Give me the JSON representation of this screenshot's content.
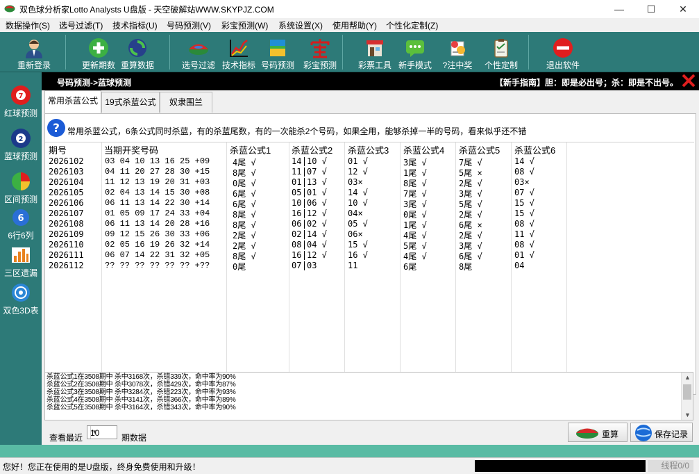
{
  "window": {
    "title": "双色球分析家Lotto Analysts U盘版 - 天空破解站WWW.SKYPJZ.COM",
    "minimize": "—",
    "maximize": "☐",
    "close": "✕"
  },
  "menu": [
    "数据操作(S)",
    "选号过滤(T)",
    "技术指标(U)",
    "号码预测(V)",
    "彩宝预测(W)",
    "系统设置(X)",
    "使用帮助(Y)",
    "个性化定制(Z)"
  ],
  "toolbar": [
    "重新登录",
    "更新期数",
    "重算数据",
    "选号过滤",
    "技术指标",
    "号码预测",
    "彩宝预测",
    "彩票工具",
    "新手模式",
    "?注中奖",
    "个性定制",
    "退出软件"
  ],
  "sidebar": [
    "红球预测",
    "蓝球预测",
    "区间预测",
    "6行6列",
    "三区遗漏",
    "双色3D表"
  ],
  "sidebar_icon_text": {
    "ball": "7",
    "two": "2",
    "six": "6"
  },
  "breadcrumb": "号码预测->蓝球预测",
  "guide": "【新手指南】胆：即是必出号；杀：即是不出号。",
  "tabs": [
    "常用杀蓝公式",
    "19式杀蓝公式",
    "奴隶围兰"
  ],
  "description": "常用杀蓝公式，6条公式同时杀蓝，有的杀蓝尾数，有的一次能杀2个号码，如果全用，能够杀掉一半的号码，看来似乎还不错",
  "headers": [
    "期号",
    "当期开奖号码",
    "杀蓝公式1",
    "杀蓝公式2",
    "杀蓝公式3",
    "杀蓝公式4",
    "杀蓝公式5",
    "杀蓝公式6"
  ],
  "rows": [
    {
      "period": "2026102",
      "numbers": "03 04 10 13 16 25 +09",
      "f1": "4尾 √",
      "f2a": "14",
      "f2b": "10 √",
      "f3": "01 √",
      "f4": "3尾 √",
      "f5": "7尾 √",
      "f6": "14 √"
    },
    {
      "period": "2026103",
      "numbers": "04 11 20 27 28 30 +15",
      "f1": "8尾 √",
      "f2a": "11",
      "f2b": "07 √",
      "f3": "12 √",
      "f4": "1尾 √",
      "f5": "5尾 ×",
      "f6": "08 √"
    },
    {
      "period": "2026104",
      "numbers": "11 12 13 19 20 31 +03",
      "f1": "0尾 √",
      "f2a": "01",
      "f2b": "13 √",
      "f3": "03×",
      "f4": "8尾 √",
      "f5": "2尾 √",
      "f6": "03×"
    },
    {
      "period": "2026105",
      "numbers": "02 04 13 14 15 30 +08",
      "f1": "6尾 √",
      "f2a": "05",
      "f2b": "01 √",
      "f3": "14 √",
      "f4": "7尾 √",
      "f5": "3尾 √",
      "f6": "07 √"
    },
    {
      "period": "2026106",
      "numbers": "06 11 13 14 22 30 +14",
      "f1": "6尾 √",
      "f2a": "10",
      "f2b": "06 √",
      "f3": "10 √",
      "f4": "3尾 √",
      "f5": "5尾 √",
      "f6": "15 √"
    },
    {
      "period": "2026107",
      "numbers": "01 05 09 17 24 33 +04",
      "f1": "8尾 √",
      "f2a": "16",
      "f2b": "12 √",
      "f3": "04×",
      "f4": "0尾 √",
      "f5": "2尾 √",
      "f6": "15 √"
    },
    {
      "period": "2026108",
      "numbers": "06 11 13 14 20 28 +16",
      "f1": "8尾 √",
      "f2a": "06",
      "f2b": "02 √",
      "f3": "05 √",
      "f4": "1尾 √",
      "f5": "6尾 ×",
      "f6": "08 √"
    },
    {
      "period": "2026109",
      "numbers": "09 12 15 26 30 33 +06",
      "f1": "2尾 √",
      "f2a": "02",
      "f2b": "14 √",
      "f3": "06×",
      "f4": "4尾 √",
      "f5": "2尾 √",
      "f6": "11 √"
    },
    {
      "period": "2026110",
      "numbers": "02 05 16 19 26 32 +14",
      "f1": "2尾 √",
      "f2a": "08",
      "f2b": "04 √",
      "f3": "15 √",
      "f4": "5尾 √",
      "f5": "3尾 √",
      "f6": "08 √"
    },
    {
      "period": "2026111",
      "numbers": "06 07 14 22 31 32 +05",
      "f1": "8尾 √",
      "f2a": "16",
      "f2b": "12 √",
      "f3": "16 √",
      "f4": "4尾 √",
      "f5": "6尾 √",
      "f6": "01 √"
    },
    {
      "period": "2026112",
      "numbers": "?? ?? ?? ?? ?? ?? +??",
      "f1": "0尾",
      "f2a": "07",
      "f2b": "03",
      "f3": "11",
      "f4": "6尾",
      "f5": "8尾",
      "f6": "04"
    }
  ],
  "stats": [
    "杀蓝公式1在3508期中 杀中3168次，杀错339次，命中率为90%",
    "杀蓝公式2在3508期中 杀中3078次，杀错429次，命中率为87%",
    "杀蓝公式3在3508期中 杀中3284次，杀错223次，命中率为93%",
    "杀蓝公式4在3508期中 杀中3141次，杀错366次，命中率为89%",
    "杀蓝公式5在3508期中 杀中3164次，杀错343次，命中率为90%"
  ],
  "bottom": {
    "view_label": "查看最近",
    "count": "10",
    "unit_label": "期数据",
    "recalc": "重算",
    "save": "保存记录"
  },
  "status": {
    "message": "您好！您正在使用的是U盘版，终身免费使用和升级！",
    "thread": "线程0/0"
  },
  "colors": {
    "toolbar": "#2d7a78",
    "strip": "#59bba4",
    "topstrip": "#000000"
  }
}
